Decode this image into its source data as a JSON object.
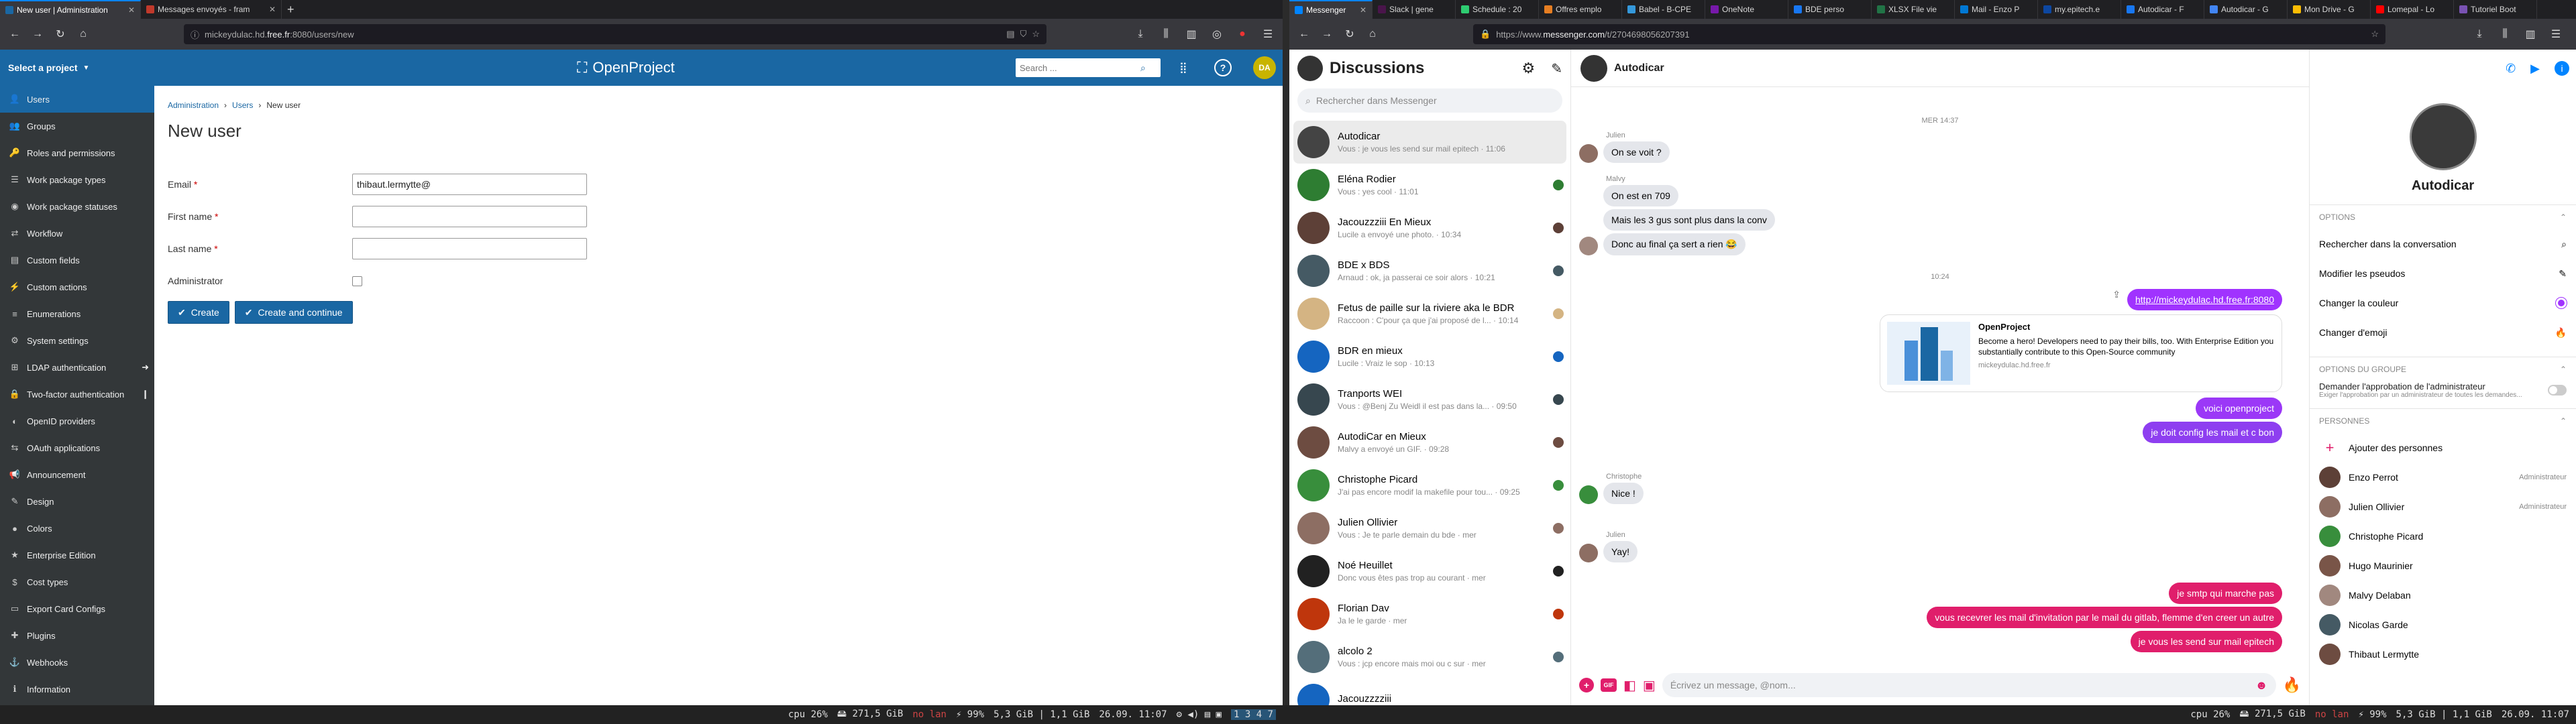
{
  "left_browser": {
    "tabs": [
      {
        "title": "New user | Administration",
        "color": "#1a67a3",
        "active": true
      },
      {
        "title": "Messages envoyés - fram",
        "color": "#c0392b",
        "active": false
      }
    ],
    "url_prefix": "mickeydulac.hd.",
    "url_domain": "free.fr",
    "url_suffix": ":8080/users/new"
  },
  "right_browser": {
    "tabs": [
      {
        "title": "Messenger",
        "color": "#0084ff",
        "active": true
      },
      {
        "title": "Slack | gene",
        "color": "#4a154b",
        "active": false
      },
      {
        "title": "Schedule : 20",
        "color": "#2ecc71",
        "active": false
      },
      {
        "title": "Offres emplo",
        "color": "#e67e22",
        "active": false
      },
      {
        "title": "Babel - B-CPE",
        "color": "#3498db",
        "active": false
      },
      {
        "title": "OneNote",
        "color": "#7719aa",
        "active": false
      },
      {
        "title": "BDE perso",
        "color": "#1877f2",
        "active": false
      },
      {
        "title": "XLSX File vie",
        "color": "#217346",
        "active": false
      },
      {
        "title": "Mail - Enzo P",
        "color": "#0078d4",
        "active": false
      },
      {
        "title": "my.epitech.e",
        "color": "#0d47a1",
        "active": false
      },
      {
        "title": "Autodicar - F",
        "color": "#1877f2",
        "active": false
      },
      {
        "title": "Autodicar - G",
        "color": "#4285f4",
        "active": false
      },
      {
        "title": "Mon Drive - G",
        "color": "#fbbc04",
        "active": false
      },
      {
        "title": "Lomepal - Lo",
        "color": "#ff0000",
        "active": false
      },
      {
        "title": "Tutoriel Boot",
        "color": "#7952b3",
        "active": false
      }
    ],
    "url_prefix": "https://www.",
    "url_domain": "messenger.com",
    "url_suffix": "/t/2704698056207391"
  },
  "openproject": {
    "project_select": "Select a project",
    "logo": "OpenProject",
    "search_placeholder": "Search ...",
    "avatar_initials": "DA",
    "sidebar": [
      {
        "label": "Users",
        "icon": "users-icon",
        "glyph": "👤",
        "active": true
      },
      {
        "label": "Groups",
        "icon": "groups-icon",
        "glyph": "👥",
        "active": false
      },
      {
        "label": "Roles and permissions",
        "icon": "roles-icon",
        "glyph": "🔑",
        "active": false
      },
      {
        "label": "Work package types",
        "icon": "types-icon",
        "glyph": "☰",
        "active": false
      },
      {
        "label": "Work package statuses",
        "icon": "statuses-icon",
        "glyph": "◉",
        "active": false
      },
      {
        "label": "Workflow",
        "icon": "workflow-icon",
        "glyph": "⇄",
        "active": false
      },
      {
        "label": "Custom fields",
        "icon": "custom-fields-icon",
        "glyph": "▤",
        "active": false
      },
      {
        "label": "Custom actions",
        "icon": "custom-actions-icon",
        "glyph": "⚡",
        "active": false
      },
      {
        "label": "Enumerations",
        "icon": "enumerations-icon",
        "glyph": "≡",
        "active": false
      },
      {
        "label": "System settings",
        "icon": "settings-icon",
        "glyph": "⚙",
        "active": false
      },
      {
        "label": "LDAP authentication",
        "icon": "ldap-icon",
        "glyph": "⊞",
        "active": false,
        "arrow": "➜"
      },
      {
        "label": "Two-factor authentication",
        "icon": "two-factor-icon",
        "glyph": "🔒",
        "active": false,
        "arrow": "❙"
      },
      {
        "label": "OpenID providers",
        "icon": "openid-icon",
        "glyph": "◐",
        "active": false
      },
      {
        "label": "OAuth applications",
        "icon": "oauth-icon",
        "glyph": "⇆",
        "active": false
      },
      {
        "label": "Announcement",
        "icon": "announcement-icon",
        "glyph": "📢",
        "active": false
      },
      {
        "label": "Design",
        "icon": "design-icon",
        "glyph": "✎",
        "active": false
      },
      {
        "label": "Colors",
        "icon": "colors-icon",
        "glyph": "●",
        "active": false
      },
      {
        "label": "Enterprise Edition",
        "icon": "enterprise-icon",
        "glyph": "★",
        "active": false
      },
      {
        "label": "Cost types",
        "icon": "cost-types-icon",
        "glyph": "$",
        "active": false
      },
      {
        "label": "Export Card Configs",
        "icon": "export-icon",
        "glyph": "▭",
        "active": false
      },
      {
        "label": "Plugins",
        "icon": "plugins-icon",
        "glyph": "✚",
        "active": false
      },
      {
        "label": "Webhooks",
        "icon": "webhooks-icon",
        "glyph": "⚓",
        "active": false
      },
      {
        "label": "Information",
        "icon": "information-icon",
        "glyph": "ℹ",
        "active": false
      }
    ],
    "breadcrumb": [
      "Administration",
      "Users",
      "New user"
    ],
    "title": "New user",
    "form": {
      "email_label": "Email",
      "email_value": "thibaut.lermytte@",
      "firstname_label": "First name",
      "firstname_value": "",
      "lastname_label": "Last name",
      "lastname_value": "",
      "admin_label": "Administrator",
      "required_mark": "*",
      "create_label": "Create",
      "create_continue_label": "Create and continue"
    }
  },
  "messenger": {
    "title": "Discussions",
    "search_placeholder": "Rechercher dans Messenger",
    "conversations": [
      {
        "name": "Autodicar",
        "preview": "Vous : je vous les send sur mail epitech · 11:06",
        "color": "#444",
        "active": true
      },
      {
        "name": "Eléna Rodier",
        "preview": "Vous : yes cool · 11:01",
        "color": "#2e7d32",
        "active": false
      },
      {
        "name": "Jacouzzziii En Mieux",
        "preview": "Lucile a envoyé une photo. · 10:34",
        "color": "#5d4037",
        "active": false
      },
      {
        "name": "BDE x BDS",
        "preview": "Arnaud : ok, ja passerai ce soir alors · 10:21",
        "color": "#455a64",
        "active": false
      },
      {
        "name": "Fetus de paille sur la riviere aka le BDR",
        "preview": "Raccoon : C'pour ça que j'ai proposé de l... · 10:14",
        "color": "#d4b483",
        "active": false
      },
      {
        "name": "BDR en mieux",
        "preview": "Lucile : Vraiz le sop · 10:13",
        "color": "#1565c0",
        "active": false
      },
      {
        "name": "Tranports WEI",
        "preview": "Vous : @Benj Zu Weidl il est pas dans la... · 09:50",
        "color": "#37474f",
        "active": false
      },
      {
        "name": "AutodiCar en Mieux",
        "preview": "Malvy a envoyé un GIF. · 09:28",
        "color": "#6d4c41",
        "active": false
      },
      {
        "name": "Christophe Picard",
        "preview": "J'ai pas encore modif la makefile pour tou... · 09:25",
        "color": "#388e3c",
        "active": false
      },
      {
        "name": "Julien Ollivier",
        "preview": "Vous : Je te parle demain du bde · mer",
        "color": "#8d6e63",
        "active": false
      },
      {
        "name": "Noé Heuillet",
        "preview": "Donc vous êtes pas trop au courant · mer",
        "color": "#212121",
        "active": false
      },
      {
        "name": "Florian Dav",
        "preview": "Ja le le garde · mer",
        "color": "#bf360c",
        "active": false
      },
      {
        "name": "alcolo 2",
        "preview": "Vous : jcp encore mais moi ou c sur · mer",
        "color": "#546e7a",
        "active": false
      },
      {
        "name": "Jacouzzzziii",
        "preview": "",
        "color": "#1565c0",
        "active": false
      }
    ],
    "chat_title": "Autodicar",
    "time_1": "MER 14:37",
    "time_2": "10:24",
    "messages_in_1": {
      "sender": "Julien",
      "text": "On se voit ?"
    },
    "messages_in_2": {
      "sender": "Malvy",
      "texts": [
        "On est en 709",
        "Mais les 3 gus sont plus dans la conv",
        "Donc au final ça sert a rien 😂"
      ]
    },
    "link_out": "http://mickeydulac.hd.free.fr:8080",
    "link_card": {
      "title": "OpenProject",
      "desc": "Become a hero! Developers need to pay their bills, too. With Enterprise Edition you substantially contribute to this Open-Source community",
      "domain": "mickeydulac.hd.free.fr"
    },
    "out_1": "voici openproject",
    "out_2": "je doit config les mail et c bon",
    "msg_christophe": {
      "sender": "Christophe",
      "text": "Nice !"
    },
    "msg_julien2": {
      "sender": "Julien",
      "text": "Yay!"
    },
    "out_3": "je smtp qui marche pas",
    "out_4": "vous recevrer les mail d'invitation par le mail du gitlab, flemme d'en creer un autre",
    "out_5": "je vous les send sur mail epitech",
    "composer_placeholder": "Écrivez un message, @nom...",
    "info": {
      "name": "Autodicar",
      "options_header": "OPTIONS",
      "options": [
        "Rechercher dans la conversation",
        "Modifier les pseudos",
        "Changer la couleur",
        "Changer d'emoji"
      ],
      "group_header": "OPTIONS DU GROUPE",
      "approval_label": "Demander l'approbation de l'administrateur",
      "approval_desc": "Exiger l'approbation par un administrateur de toutes les demandes...",
      "people_header": "PERSONNES",
      "add_people": "Ajouter des personnes",
      "people": [
        {
          "name": "Enzo Perrot",
          "role": "Administrateur",
          "color": "#5d4037"
        },
        {
          "name": "Julien Ollivier",
          "role": "Administrateur",
          "color": "#8d6e63"
        },
        {
          "name": "Christophe Picard",
          "role": "",
          "color": "#388e3c"
        },
        {
          "name": "Hugo Maurinier",
          "role": "",
          "color": "#795548"
        },
        {
          "name": "Malvy Delaban",
          "role": "",
          "color": "#a1887f"
        },
        {
          "name": "Nicolas Garde",
          "role": "",
          "color": "#455a64"
        },
        {
          "name": "Thibaut Lermytte",
          "role": "",
          "color": "#6d4c41"
        }
      ]
    }
  },
  "status_left": {
    "cpu": "cpu  26%",
    "ram": "271,5 GiB",
    "lan": "no lan",
    "bat": "99%",
    "mem": "5,3 GiB | 1,1 GiB",
    "date": "26.09. 11:07",
    "ws": "1  3  4  7"
  },
  "status_right": {
    "cpu": "cpu  26%",
    "ram": "271,5 GiB",
    "lan": "no lan",
    "bat": "99%",
    "mem": "5,3 GiB | 1,1 GiB",
    "date": "26.09. 11:07"
  },
  "colors": {
    "op_blue": "#1a67a3",
    "messenger_purple": "#a033ff",
    "messenger_pink": "#e01e6b",
    "messenger_blue": "#0084ff"
  }
}
